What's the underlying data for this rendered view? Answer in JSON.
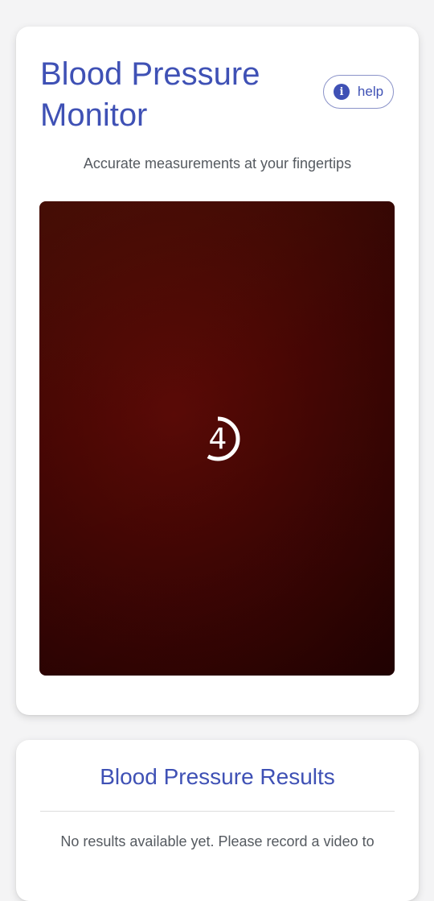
{
  "header": {
    "title": "Blood Pressure Monitor",
    "help_label": "help",
    "subtitle": "Accurate measurements at your fingertips"
  },
  "camera": {
    "countdown": "4",
    "countdown_progress": 0.58
  },
  "results": {
    "title": "Blood Pressure Results",
    "empty_message": "No results available yet. Please record a video to"
  },
  "colors": {
    "accent": "#3f51b5",
    "camera_bg": "#4b0704",
    "page_bg": "#f4f4f5"
  }
}
